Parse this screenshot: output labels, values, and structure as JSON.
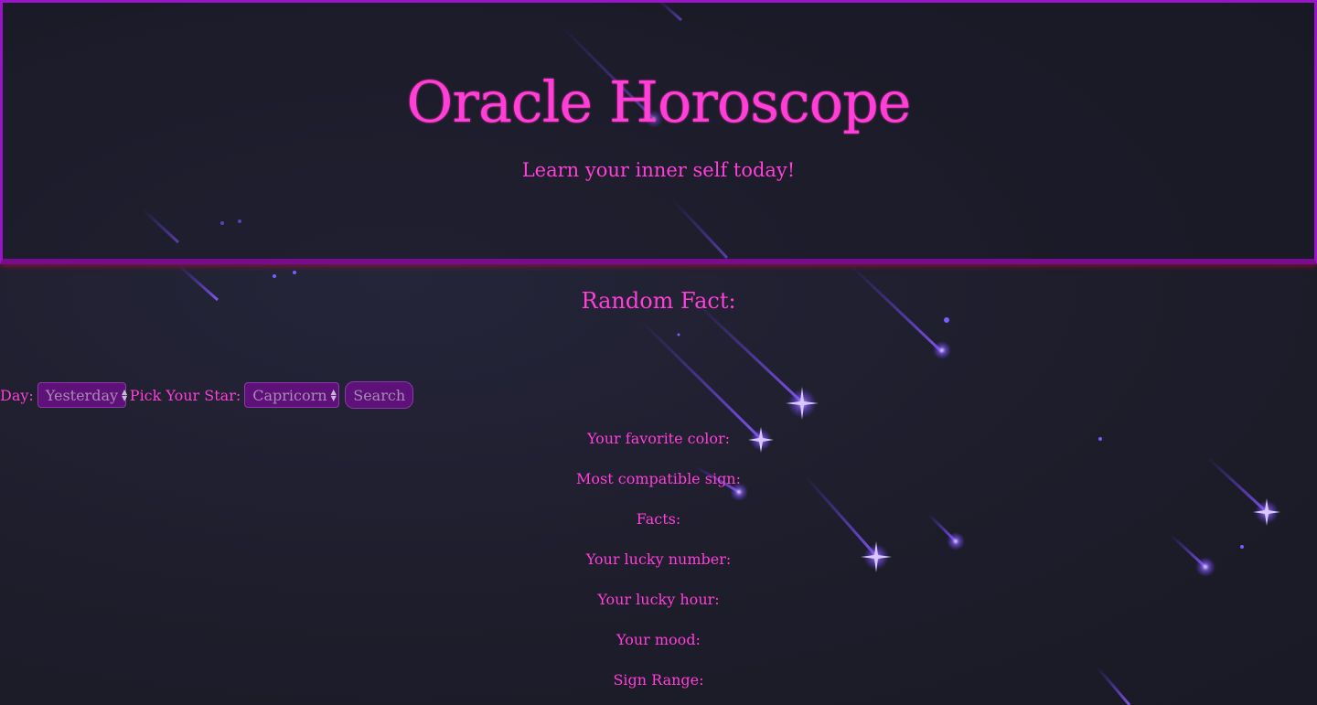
{
  "header": {
    "title": "Oracle Horoscope",
    "subtitle": "Learn your inner self today!"
  },
  "random_fact": {
    "heading": "Random Fact:"
  },
  "controls": {
    "day_label": "Day:",
    "day_selected": "Yesterday",
    "star_label": "Pick Your Star:",
    "star_selected": "Capricorn",
    "search_label": "Search"
  },
  "results": {
    "favorite_color": "Your favorite color:",
    "compatible_sign": "Most compatible sign:",
    "facts": "Facts:",
    "lucky_number": "Your lucky number:",
    "lucky_hour": "Your lucky hour:",
    "mood": "Your mood:",
    "sign_range": "Sign Range:"
  },
  "colors": {
    "accent_text": "#ff3fd8",
    "banner_border": "#9a14c8",
    "control_bg": "#5e1178",
    "background": "#1c1c2a",
    "shooting_star": "#7a4cff"
  }
}
